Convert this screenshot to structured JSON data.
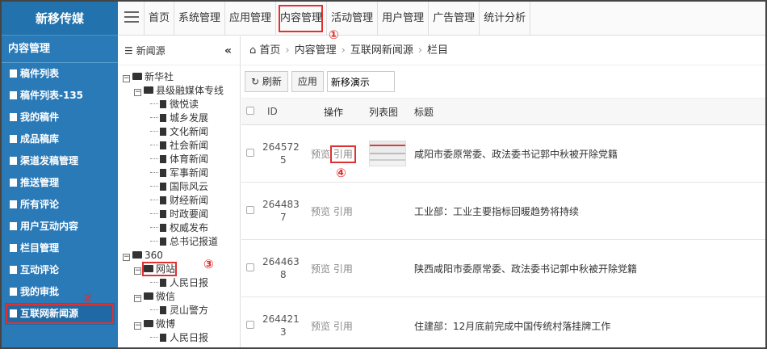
{
  "brand": "新移传媒",
  "sidebar": {
    "section": "内容管理",
    "items": [
      {
        "label": "稿件列表"
      },
      {
        "label": "稿件列表-135"
      },
      {
        "label": "我的稿件"
      },
      {
        "label": "成品稿库"
      },
      {
        "label": "渠道发稿管理"
      },
      {
        "label": "推送管理"
      },
      {
        "label": "所有评论"
      },
      {
        "label": "用户互动内容"
      },
      {
        "label": "栏目管理"
      },
      {
        "label": "互动评论"
      },
      {
        "label": "我的审批"
      },
      {
        "label": "互联网新闻源"
      }
    ]
  },
  "topnav": {
    "tabs": [
      "首页",
      "系统管理",
      "应用管理",
      "内容管理",
      "活动管理",
      "用户管理",
      "广告管理",
      "统计分析"
    ]
  },
  "tree": {
    "header": "新闻源",
    "collapse": "«",
    "nodes": {
      "xinhua": "新华社",
      "xianji": "县级融媒体专线",
      "x1": "微悦读",
      "x2": "城乡发展",
      "x3": "文化新闻",
      "x4": "社会新闻",
      "x5": "体育新闻",
      "x6": "军事新闻",
      "x7": "国际风云",
      "x8": "财经新闻",
      "x9": "时政要闻",
      "x10": "权威发布",
      "x11": "总书记报道",
      "s360": "360",
      "wangzhan": "网站",
      "w1": "人民日报",
      "weixin": "微信",
      "wx1": "灵山警方",
      "weibo": "微博",
      "wb1": "人民日报"
    }
  },
  "breadcrumb": {
    "home": "首页",
    "sep": "›",
    "l1": "内容管理",
    "l2": "互联网新闻源",
    "l3": "栏目"
  },
  "toolbar": {
    "refresh": "刷新",
    "apply": "应用",
    "input_value": "新移演示"
  },
  "table": {
    "headers": {
      "id": "ID",
      "op": "操作",
      "thumb": "列表图",
      "title": "标题"
    },
    "preview": "预览",
    "cite": "引用",
    "rows": [
      {
        "id_a": "264572",
        "id_b": "5",
        "title": "咸阳市委原常委、政法委书记郭中秋被开除党籍"
      },
      {
        "id_a": "264483",
        "id_b": "7",
        "title": "工业部：工业主要指标回暖趋势将持续"
      },
      {
        "id_a": "264463",
        "id_b": "8",
        "title": "陕西咸阳市委原常委、政法委书记郭中秋被开除党籍"
      },
      {
        "id_a": "264421",
        "id_b": "3",
        "title": "住建部：12月底前完成中国传统村落挂牌工作"
      }
    ]
  },
  "markers": {
    "m1": "①",
    "m2": "②",
    "m3": "③",
    "m4": "④"
  },
  "colors": {
    "sidebar": "#2a7ab8",
    "highlight": "#e03030"
  }
}
